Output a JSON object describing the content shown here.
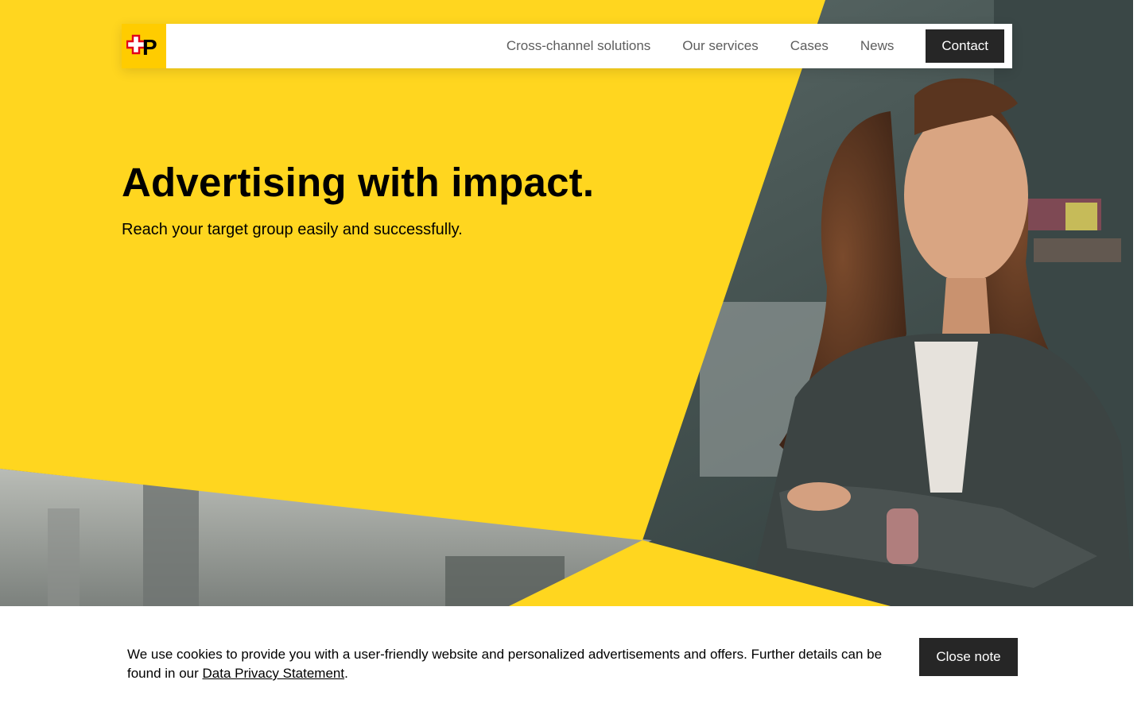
{
  "colors": {
    "brand_yellow": "#ffcc00",
    "hero_yellow": "#ffd61f",
    "dark_button": "#262626",
    "nav_text": "#5d5d5d"
  },
  "header": {
    "logo_icon": "swiss-post-logo",
    "logo_letter": "P",
    "nav": [
      {
        "label": "Cross-channel solutions"
      },
      {
        "label": "Our services"
      },
      {
        "label": "Cases"
      },
      {
        "label": "News"
      }
    ],
    "contact_label": "Contact"
  },
  "hero": {
    "title": "Advertising with impact.",
    "subtitle": "Reach your target group easily and successfully.",
    "image": "woman-smiling-arms-crossed-office-photo"
  },
  "cookie": {
    "text_before": "We use cookies to provide you with a user-friendly website and personalized advertisements and offers. Further details can be found in our ",
    "link_label": "Data Privacy Statement",
    "text_after": ".",
    "close_label": "Close note"
  }
}
